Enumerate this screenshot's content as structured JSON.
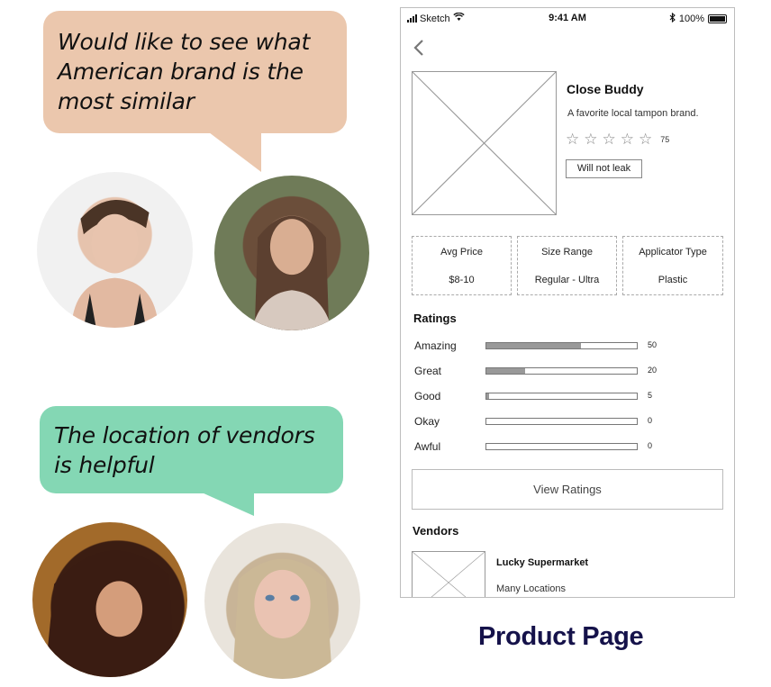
{
  "quotes": [
    {
      "text_lines": [
        "Would like to see what",
        "American brand is the",
        "most similar"
      ],
      "color": "#ebc7ad"
    },
    {
      "text_lines": [
        "The location of vendors",
        "is helpful"
      ],
      "color": "#84d7b4"
    }
  ],
  "status_bar": {
    "carrier": "Sketch",
    "time": "9:41 AM",
    "battery": "100%"
  },
  "product": {
    "name": "Close Buddy",
    "description": "A favorite local tampon brand.",
    "star_count": 5,
    "review_count": "75",
    "badge": "Will not leak"
  },
  "stats": [
    {
      "label": "Avg Price",
      "value": "$8-10"
    },
    {
      "label": "Size Range",
      "value": "Regular - Ultra"
    },
    {
      "label": "Applicator Type",
      "value": "Plastic"
    }
  ],
  "ratings": {
    "heading": "Ratings",
    "rows": [
      {
        "label": "Amazing",
        "count": "50",
        "fraction": 0.63
      },
      {
        "label": "Great",
        "count": "20",
        "fraction": 0.26
      },
      {
        "label": "Good",
        "count": "5",
        "fraction": 0.02
      },
      {
        "label": "Okay",
        "count": "0",
        "fraction": 0
      },
      {
        "label": "Awful",
        "count": "0",
        "fraction": 0
      }
    ],
    "button_label": "View Ratings"
  },
  "vendors": {
    "heading": "Vendors",
    "items": [
      {
        "name": "Lucky Supermarket",
        "location": "Many Locations"
      }
    ]
  },
  "caption": "Product Page"
}
